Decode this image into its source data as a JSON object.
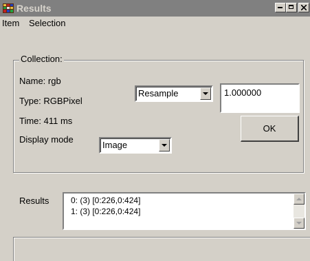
{
  "window": {
    "title": "Results",
    "icon": "film-app-icon"
  },
  "titlebar_buttons": {
    "minimize": "_",
    "maximize": "□",
    "close": "×"
  },
  "menu": {
    "items": [
      "Item",
      "Selection"
    ]
  },
  "collection": {
    "legend": "Collection:",
    "name_label": "Name: rgb",
    "type_label": "Type: RGBPixel",
    "time_label": "Time: 411 ms",
    "display_mode_label": "Display mode",
    "display_mode_value": "Image",
    "resample_value": "Resample",
    "factor_value": "1.000000",
    "ok_label": "OK"
  },
  "results": {
    "label": "Results",
    "items": [
      "0: (3) [0:226,0:424]",
      "1: (3) [0:226,0:424]"
    ]
  },
  "colors": {
    "titlebar_inactive": "#808080",
    "face": "#d4d0c8"
  }
}
